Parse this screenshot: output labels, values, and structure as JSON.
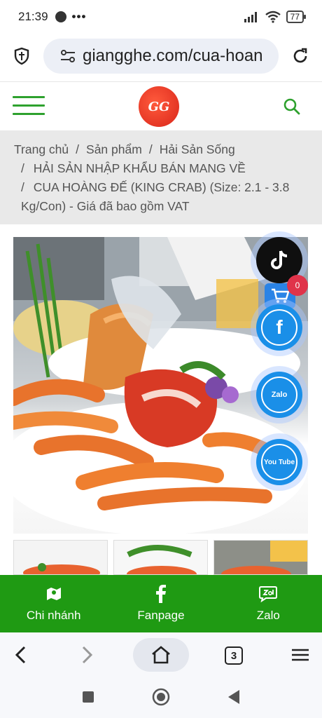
{
  "status_bar": {
    "time": "21:39",
    "dots": "•••",
    "battery": "77"
  },
  "browser": {
    "url": "giangghe.com/cua-hoan",
    "tab_count": "3"
  },
  "site": {
    "logo_text": "GG"
  },
  "breadcrumb": {
    "items": [
      "Trang chủ",
      "Sản phẩm",
      "Hải Sản Sống",
      "HẢI SẢN NHẬP KHẨU BÁN MANG VỀ"
    ],
    "current_line1": "CUA HOÀNG ĐẾ (KING CRAB) (Size: 2.1 - 3.8",
    "current_line2": "Kg/Con) - Giá đã bao gồm VAT",
    "separator": "/"
  },
  "floating": {
    "cart_count": "0",
    "zalo_label": "Zalo",
    "youtube_label": "You Tube"
  },
  "bottom_nav": {
    "items": [
      {
        "label": "Chi nhánh",
        "icon": "map-icon"
      },
      {
        "label": "Fanpage",
        "icon": "facebook-icon"
      },
      {
        "label": "Zalo",
        "icon": "zalo-icon"
      }
    ]
  },
  "colors": {
    "brand_green": "#1f9a13",
    "accent_blue": "#1a8fe8",
    "badge_red": "#e0334a"
  }
}
